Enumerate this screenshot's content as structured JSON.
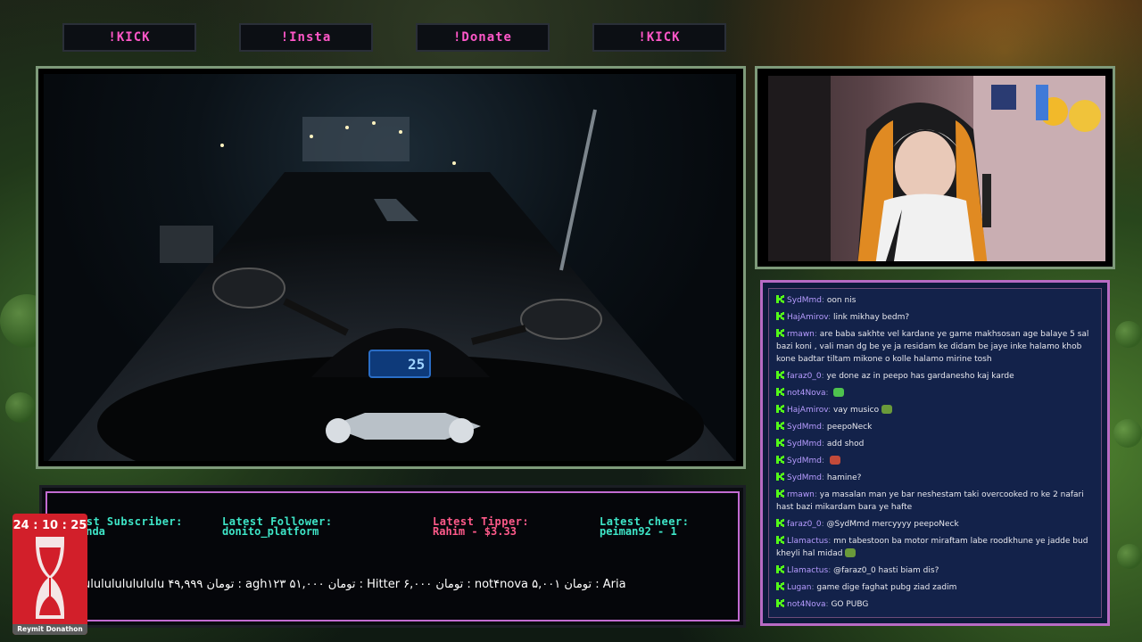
{
  "commands": [
    "!KICK",
    "!Insta",
    "!Donate",
    "!KICK"
  ],
  "colors": {
    "accent_pink": "#ff57c8",
    "label_green": "#3ee6c8",
    "label_tipper": "#ff5a8a",
    "chat_bg": "#13224a"
  },
  "stats": {
    "subscriber": {
      "label": "est Subscriber:",
      "value": "anda"
    },
    "follower": {
      "label": "Latest Follower:",
      "value": "donito_platform"
    },
    "tipper": {
      "label": "Latest Tipper:",
      "value": "Rahim - $3.33"
    },
    "cheer": {
      "label": "Latest cheer:",
      "value": "peiman92 - 1"
    }
  },
  "ticker": "ulululululululu   ۴۹,۹۹۹ تومان : agh۱۲۳   ۵۱,۰۰۰ تومان : Hitter   ۶,۰۰۰ تومان : not۴nova   ۵,۰۰۱ تومان : Aria",
  "timer": {
    "time": "24 : 10 : 25",
    "label": "Reymit Donathon"
  },
  "bike_display": "25",
  "chat": [
    {
      "user": "SydMmd",
      "text": "oon nis",
      "emote": ""
    },
    {
      "user": "HajAmirov",
      "text": "link mikhay bedm?",
      "emote": ""
    },
    {
      "user": "rmawn",
      "text": "are baba sakhte vel kardane ye game makhsosan age balaye 5 sal bazi koni , vali man dg be ye ja residam ke didam be jaye inke halamo khob kone badtar tiltam mikone o kolle halamo mirine tosh",
      "emote": ""
    },
    {
      "user": "faraz0_0",
      "text": "ye done az in peepo has gardanesho kaj karde",
      "emote": ""
    },
    {
      "user": "not4Nova",
      "text": "",
      "emote": "green"
    },
    {
      "user": "HajAmirov",
      "text": "vay musico",
      "emote": "frog"
    },
    {
      "user": "SydMmd",
      "text": "peepoNeck",
      "emote": ""
    },
    {
      "user": "SydMmd",
      "text": "add shod",
      "emote": ""
    },
    {
      "user": "SydMmd",
      "text": "",
      "emote": "red"
    },
    {
      "user": "SydMmd",
      "text": "hamine?",
      "emote": ""
    },
    {
      "user": "rmawn",
      "text": "ya masalan man ye bar neshestam taki overcooked ro ke 2 nafari hast bazi mikardam bara ye hafte",
      "emote": ""
    },
    {
      "user": "faraz0_0",
      "text": "@SydMmd mercyyyy peepoNeck",
      "emote": ""
    },
    {
      "user": "Llamactus",
      "text": "mn tabestoon ba motor miraftam labe roodkhune ye jadde bud kheyli hal midad",
      "emote": "frog"
    },
    {
      "user": "Llamactus",
      "text": "@faraz0_0 hasti biam dis?",
      "emote": ""
    },
    {
      "user": "Lugan",
      "text": "game dige faghat pubg ziad zadim",
      "emote": ""
    },
    {
      "user": "not4Nova",
      "text": "GO PUBG",
      "emote": ""
    }
  ]
}
